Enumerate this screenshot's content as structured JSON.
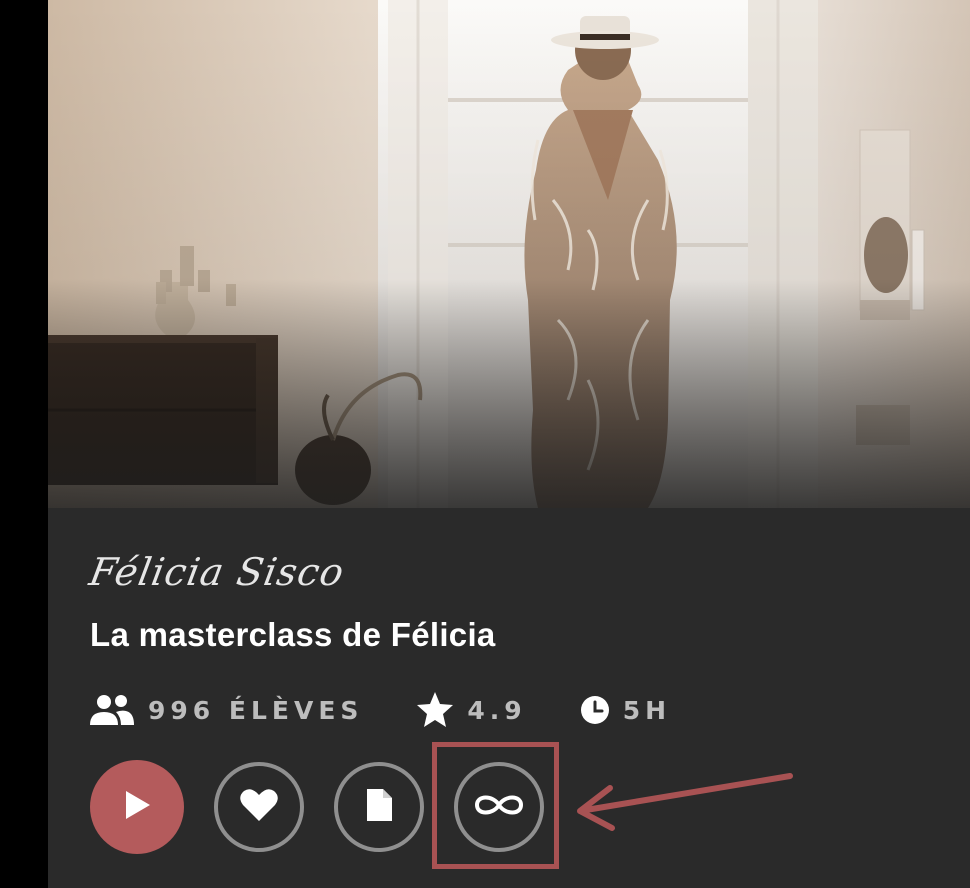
{
  "course": {
    "instructor_name": "Félicia Sisco",
    "title": "La masterclass de Félicia",
    "students": "996 ÉLÈVES",
    "rating": "4.9",
    "duration": "5H"
  },
  "icons": {
    "students": "users-icon",
    "rating": "star-icon",
    "duration": "clock-icon",
    "play": "play-icon",
    "favorite": "heart-icon",
    "document": "document-icon",
    "unlimited": "infinity-icon"
  },
  "colors": {
    "panel_background": "#2a2a2a",
    "accent": "#b45b5c",
    "annotation": "#a85253"
  }
}
